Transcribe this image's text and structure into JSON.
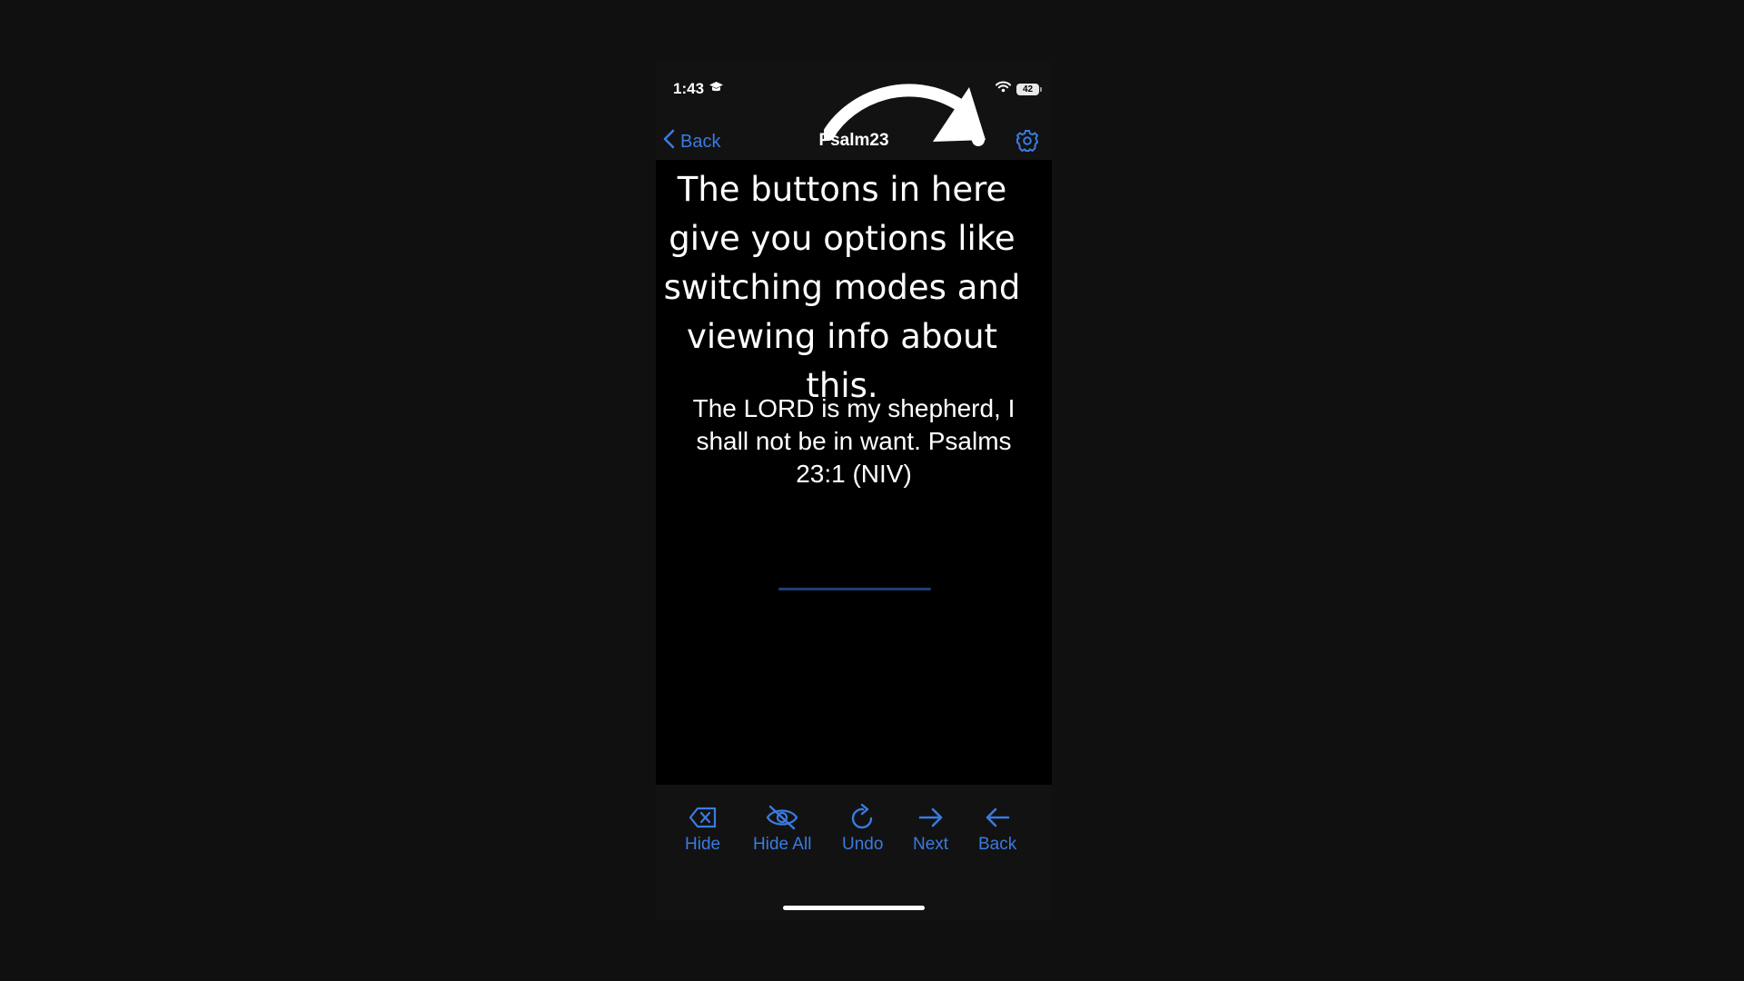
{
  "status_bar": {
    "time": "1:43",
    "battery": "42"
  },
  "nav": {
    "back_label": "Back",
    "title": "Psalm23"
  },
  "tooltip": {
    "text": "The buttons in here give you options like switching modes and viewing info about this."
  },
  "verse": {
    "text": "The LORD is my shepherd, I shall not be in want. Psalms 23:1 (NIV)"
  },
  "toolbar": {
    "items": [
      {
        "label": "Hide",
        "icon": "delete-left-icon"
      },
      {
        "label": "Hide All",
        "icon": "eye-slash-icon"
      },
      {
        "label": "Undo",
        "icon": "rotate-clockwise-icon"
      },
      {
        "label": "Next",
        "icon": "arrow-right-icon"
      },
      {
        "label": "Back",
        "icon": "arrow-left-icon"
      }
    ]
  },
  "colors": {
    "accent": "#3a7be0",
    "background": "#101010",
    "content_background": "#000000",
    "text": "#ffffff"
  }
}
